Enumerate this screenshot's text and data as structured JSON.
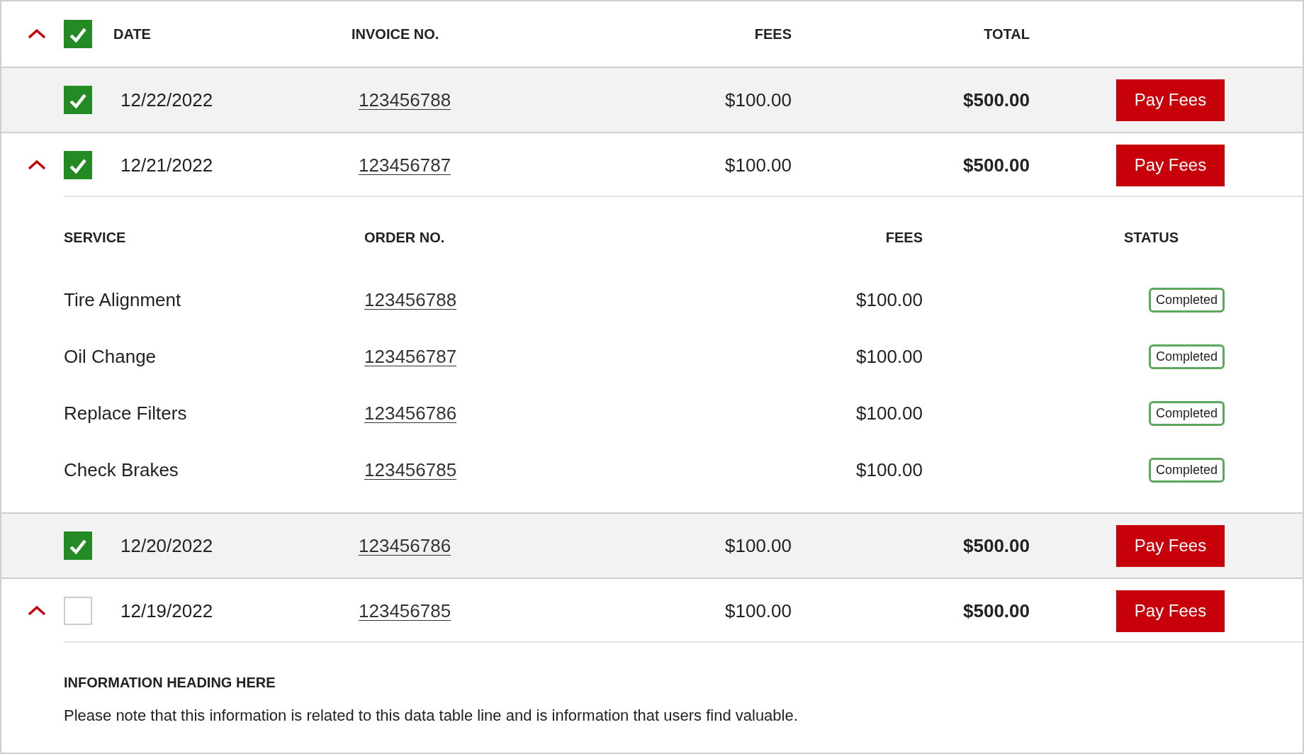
{
  "header": {
    "expanded": true,
    "checked": true,
    "columns": [
      "DATE",
      "INVOICE NO.",
      "FEES",
      "TOTAL"
    ]
  },
  "rows": [
    {
      "date": "12/22/2022",
      "invoice": "123456788",
      "fees": "$100.00",
      "total": "$500.00",
      "action": "Pay Fees",
      "checked": true,
      "expanded": false
    },
    {
      "date": "12/21/2022",
      "invoice": "123456787",
      "fees": "$100.00",
      "total": "$500.00",
      "action": "Pay Fees",
      "checked": true,
      "expanded": true,
      "detail": {
        "kind": "services",
        "columns": [
          "SERVICE",
          "ORDER NO.",
          "FEES",
          "STATUS"
        ],
        "items": [
          {
            "service": "Tire Alignment",
            "order": "123456788",
            "fees": "$100.00",
            "status": "Completed"
          },
          {
            "service": "Oil Change",
            "order": "123456787",
            "fees": "$100.00",
            "status": "Completed"
          },
          {
            "service": "Replace Filters",
            "order": "123456786",
            "fees": "$100.00",
            "status": "Completed"
          },
          {
            "service": "Check Brakes",
            "order": "123456785",
            "fees": "$100.00",
            "status": "Completed"
          }
        ]
      }
    },
    {
      "date": "12/20/2022",
      "invoice": "123456786",
      "fees": "$100.00",
      "total": "$500.00",
      "action": "Pay Fees",
      "checked": true,
      "expanded": false
    },
    {
      "date": "12/19/2022",
      "invoice": "123456785",
      "fees": "$100.00",
      "total": "$500.00",
      "action": "Pay Fees",
      "checked": false,
      "expanded": true,
      "detail": {
        "kind": "info",
        "heading": "INFORMATION HEADING HERE",
        "text": "Please note that this information is related to this data table line and is information that users find valuable."
      }
    }
  ]
}
